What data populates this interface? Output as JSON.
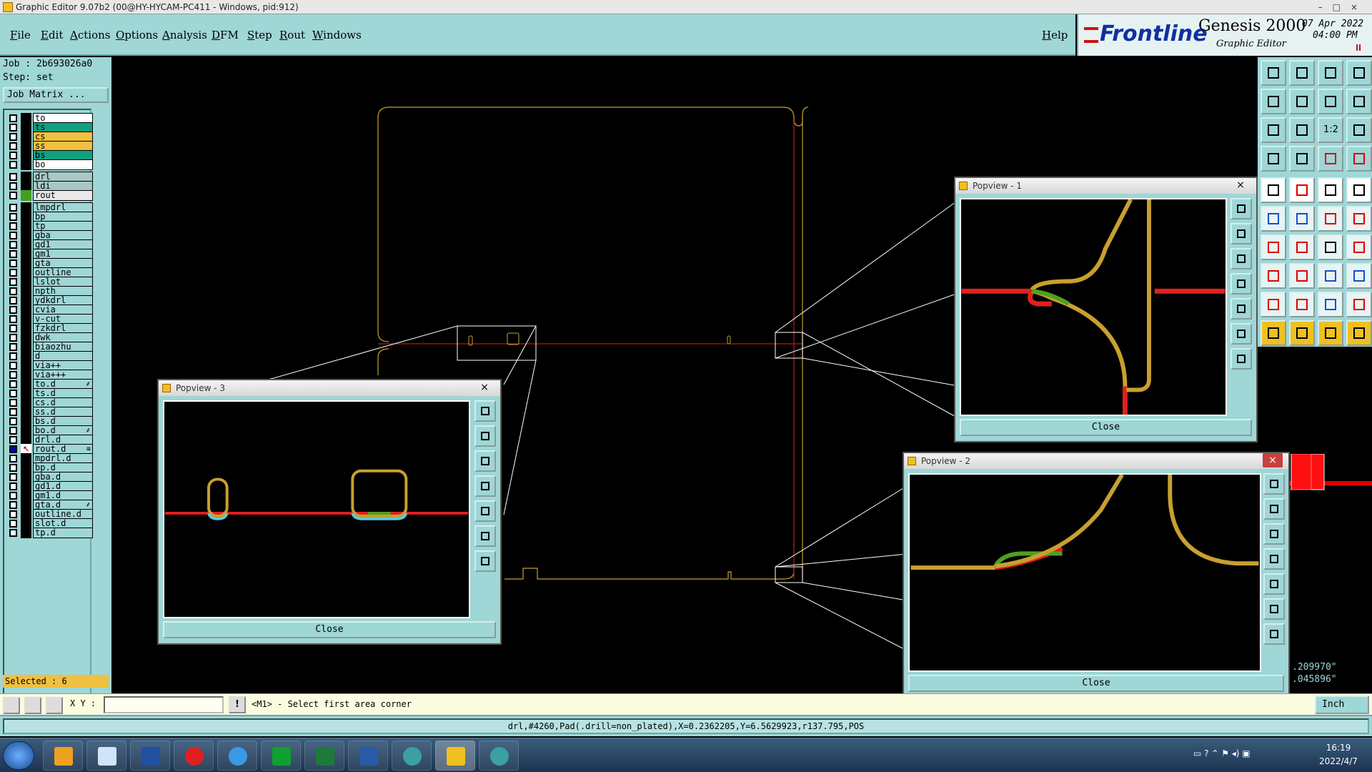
{
  "window": {
    "title": "Graphic Editor 9.07b2 (00@HY-HYCAM-PC411 - Windows, pid:912)",
    "controls": [
      "–",
      "□",
      "×"
    ]
  },
  "menu": {
    "items": [
      "File",
      "Edit",
      "Actions",
      "Options",
      "Analysis",
      "DFM",
      "Step",
      "Rout",
      "Windows"
    ],
    "help": "Help"
  },
  "brand": {
    "logo": "Frontline",
    "product": "Genesis 2000",
    "subtitle": "Graphic Editor",
    "date": "07 Apr 2022",
    "time": "04:00 PM"
  },
  "job": {
    "job_line": "Job : 2b693026a0",
    "step_line": "Step: set",
    "matrix_button": "Job Matrix ..."
  },
  "layers": [
    {
      "name": "to",
      "color": "#ffffff",
      "mark": "",
      "checked": false
    },
    {
      "name": "ts",
      "color": "#10a080",
      "mark": "",
      "checked": false
    },
    {
      "name": "cs",
      "color": "#f0c040",
      "mark": "",
      "checked": false
    },
    {
      "name": "ss",
      "color": "#f0c040",
      "mark": "",
      "checked": false
    },
    {
      "name": "bs",
      "color": "#10a080",
      "mark": "",
      "checked": false
    },
    {
      "name": "bo",
      "color": "#ffffff",
      "mark": "",
      "checked": false
    },
    {
      "name": "drl",
      "color": "#a8c8c8",
      "mark": "",
      "checked": false
    },
    {
      "name": "ldi",
      "color": "#a8c8c8",
      "mark": "",
      "checked": false
    },
    {
      "name": "rout",
      "color": "#e8e8e8",
      "mark": "green",
      "checked": false
    },
    {
      "name": "lmpdrl",
      "color": "#9fd6d6",
      "mark": "",
      "checked": false
    },
    {
      "name": "bp",
      "color": "#9fd6d6",
      "mark": "",
      "checked": false
    },
    {
      "name": "tp",
      "color": "#9fd6d6",
      "mark": "",
      "checked": false
    },
    {
      "name": "gba",
      "color": "#9fd6d6",
      "mark": "",
      "checked": false
    },
    {
      "name": "gd1",
      "color": "#9fd6d6",
      "mark": "",
      "checked": false
    },
    {
      "name": "gm1",
      "color": "#9fd6d6",
      "mark": "",
      "checked": false
    },
    {
      "name": "gta",
      "color": "#9fd6d6",
      "mark": "",
      "checked": false
    },
    {
      "name": "outline",
      "color": "#9fd6d6",
      "mark": "",
      "checked": false
    },
    {
      "name": "lslot",
      "color": "#9fd6d6",
      "mark": "",
      "checked": false
    },
    {
      "name": "npth",
      "color": "#9fd6d6",
      "mark": "",
      "checked": false
    },
    {
      "name": "ydkdrl",
      "color": "#9fd6d6",
      "mark": "",
      "checked": false
    },
    {
      "name": "cvia",
      "color": "#9fd6d6",
      "mark": "",
      "checked": false
    },
    {
      "name": "v-cut",
      "color": "#9fd6d6",
      "mark": "",
      "checked": false
    },
    {
      "name": "fzkdrl",
      "color": "#9fd6d6",
      "mark": "",
      "checked": false
    },
    {
      "name": "dwk",
      "color": "#9fd6d6",
      "mark": "",
      "checked": false
    },
    {
      "name": "biaozhu",
      "color": "#9fd6d6",
      "mark": "",
      "checked": false
    },
    {
      "name": "d",
      "color": "#9fd6d6",
      "mark": "",
      "checked": false
    },
    {
      "name": "via++",
      "color": "#9fd6d6",
      "mark": "",
      "checked": false
    },
    {
      "name": "via+++",
      "color": "#9fd6d6",
      "mark": "",
      "checked": false
    },
    {
      "name": "to.d",
      "color": "#9fd6d6",
      "mark": "",
      "checked": false,
      "flag": "⸙"
    },
    {
      "name": "ts.d",
      "color": "#9fd6d6",
      "mark": "",
      "checked": false
    },
    {
      "name": "cs.d",
      "color": "#9fd6d6",
      "mark": "",
      "checked": false
    },
    {
      "name": "ss.d",
      "color": "#9fd6d6",
      "mark": "",
      "checked": false
    },
    {
      "name": "bs.d",
      "color": "#9fd6d6",
      "mark": "",
      "checked": false
    },
    {
      "name": "bo.d",
      "color": "#9fd6d6",
      "mark": "",
      "checked": false,
      "flag": "⸙"
    },
    {
      "name": "drl.d",
      "color": "#9fd6d6",
      "mark": "",
      "checked": false
    },
    {
      "name": "rout.d",
      "color": "#9fd6d6",
      "mark": "arrow",
      "checked": true,
      "flag": "≡"
    },
    {
      "name": "mpdrl.d",
      "color": "#9fd6d6",
      "mark": "",
      "checked": false
    },
    {
      "name": "bp.d",
      "color": "#9fd6d6",
      "mark": "",
      "checked": false
    },
    {
      "name": "gba.d",
      "color": "#9fd6d6",
      "mark": "",
      "checked": false
    },
    {
      "name": "gd1.d",
      "color": "#9fd6d6",
      "mark": "",
      "checked": false
    },
    {
      "name": "gm1.d",
      "color": "#9fd6d6",
      "mark": "",
      "checked": false
    },
    {
      "name": "gta.d",
      "color": "#9fd6d6",
      "mark": "",
      "checked": false,
      "flag": "⸙"
    },
    {
      "name": "outline.d",
      "color": "#9fd6d6",
      "mark": "",
      "checked": false
    },
    {
      "name": "slot.d",
      "color": "#9fd6d6",
      "mark": "",
      "checked": false
    },
    {
      "name": "tp.d",
      "color": "#9fd6d6",
      "mark": "",
      "checked": false
    }
  ],
  "selected": "Selected : 6",
  "popviews": [
    {
      "id": 1,
      "title": "Popview - 1",
      "close_label": "Close",
      "close_x": "×",
      "active": false
    },
    {
      "id": 2,
      "title": "Popview - 2",
      "close_label": "Close",
      "close_x": "×",
      "active": true
    },
    {
      "id": 3,
      "title": "Popview - 3",
      "close_label": "Close",
      "close_x": "×",
      "active": false
    }
  ],
  "toolbox": {
    "zoom_label": "1:2"
  },
  "coordinates": {
    "x": ".209970\"",
    "y": ".045896\""
  },
  "command": {
    "xy_label": "X Y :",
    "xy_value": "",
    "message_icon": "!",
    "message": "<M1> - Select first area corner",
    "units": "Inch"
  },
  "status": {
    "text": "drl,#4260,Pad(.drill=non_plated),X=0.2362205,Y=6.5629923,r137.795,POS"
  },
  "taskbar": {
    "time": "16:19",
    "date": "2022/4/7"
  },
  "colors": {
    "panel": "#9fd6d6",
    "outline": "#c8a030",
    "rout": "#e02020",
    "selected": "#f0c040",
    "highlight_green": "#50a020",
    "cyan": "#60c8e0"
  }
}
